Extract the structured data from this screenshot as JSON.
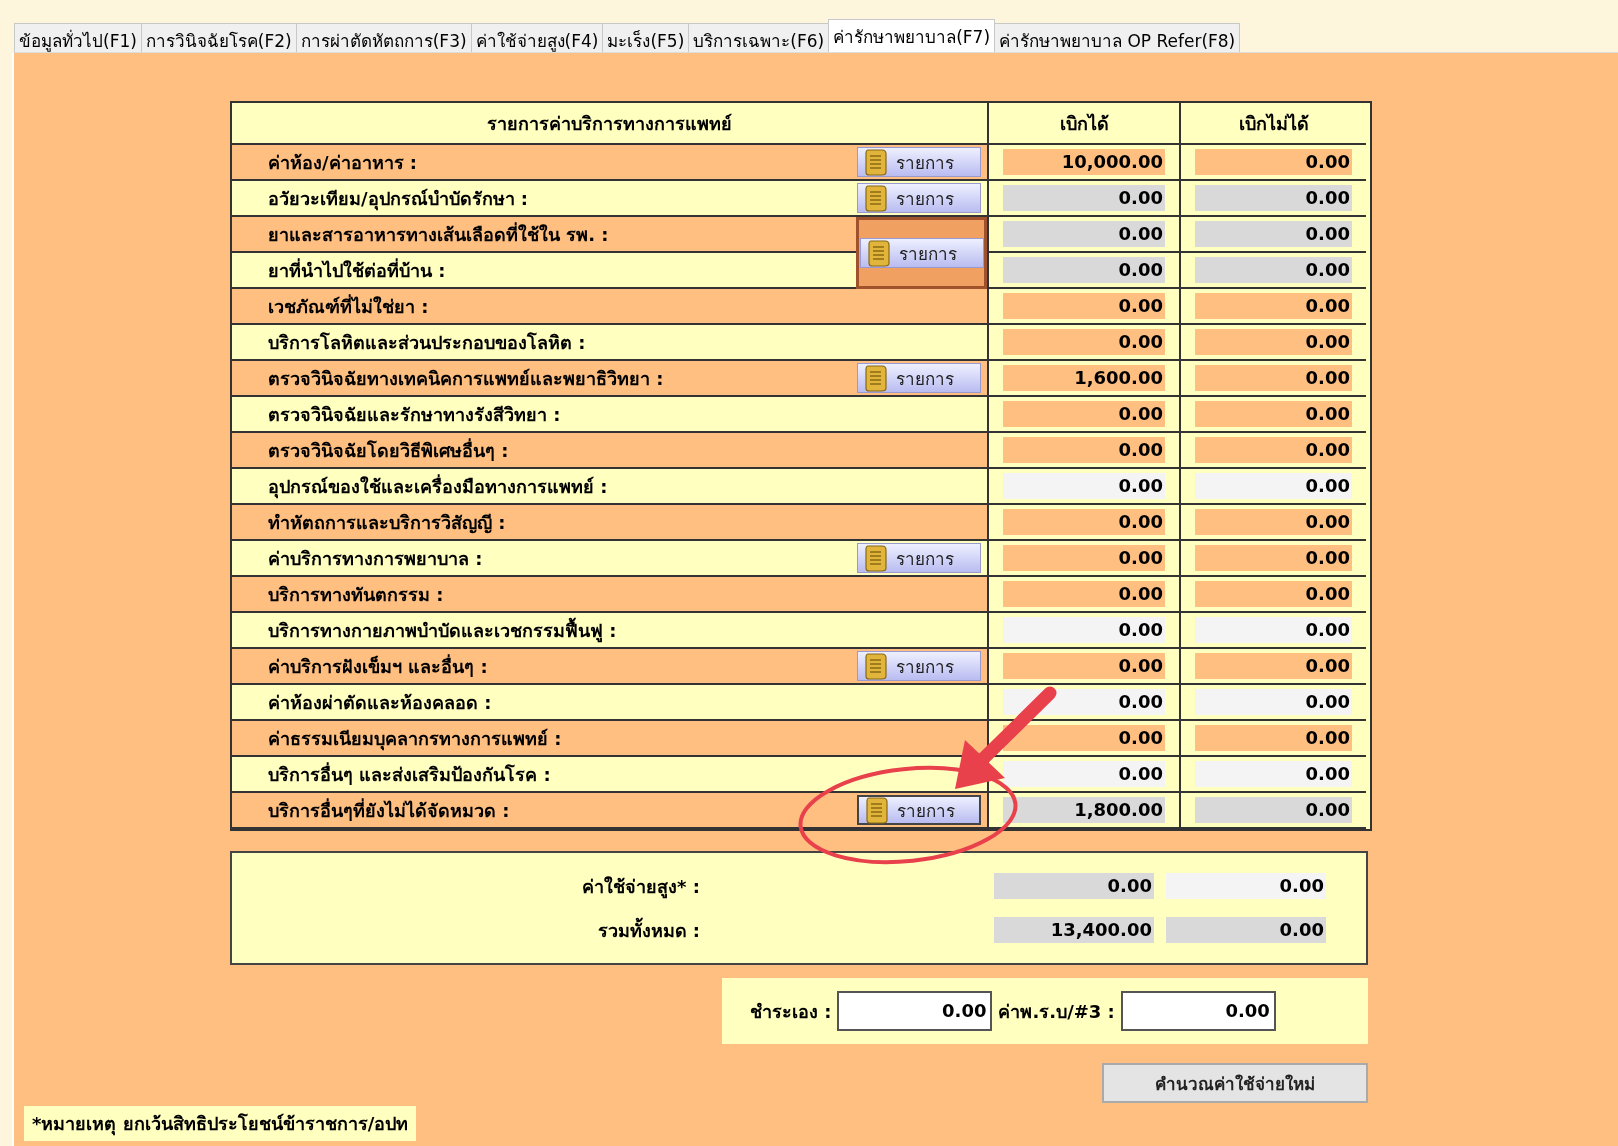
{
  "tabs": [
    {
      "label": "ข้อมูลทั่วไป(F1)",
      "selected": false
    },
    {
      "label": "การวินิจฉัยโรค(F2)",
      "selected": false
    },
    {
      "label": "การผ่าตัดหัตถการ(F3)",
      "selected": false
    },
    {
      "label": "ค่าใช้จ่ายสูง(F4)",
      "selected": false
    },
    {
      "label": "มะเร็ง(F5)",
      "selected": false
    },
    {
      "label": "บริการเฉพาะ(F6)",
      "selected": false
    },
    {
      "label": "ค่ารักษาพยาบาล(F7)",
      "selected": true
    },
    {
      "label": "ค่ารักษาพยาบาล OP Refer(F8)",
      "selected": false
    }
  ],
  "table": {
    "columns": [
      "รายการค่าบริการทางการแพทย์",
      "เบิกได้",
      "เบิกไม่ได้"
    ],
    "rows": [
      {
        "label": "ค่าห้อง/ค่าอาหาร :",
        "button": {
          "label": "รายการ",
          "highlighted": false,
          "focused": false
        },
        "claimable": {
          "value": "10,000.00",
          "color": "#ffbf80"
        },
        "non_claimable": {
          "value": "0.00",
          "color": "#ffbf80"
        }
      },
      {
        "label": "อวัยวะเทียม/อุปกรณ์บำบัดรักษา :",
        "button": {
          "label": "รายการ",
          "highlighted": false,
          "focused": false
        },
        "claimable": {
          "value": "0.00",
          "color": "#d9d9d9"
        },
        "non_claimable": {
          "value": "0.00",
          "color": "#d9d9d9"
        }
      },
      {
        "label": "ยาและสารอาหารทางเส้นเลือดที่ใช้ใน รพ. :",
        "button": {
          "label": "รายการ",
          "spans_next": true,
          "highlighted": true,
          "focused": false
        },
        "claimable": {
          "value": "0.00",
          "color": "#d9d9d9"
        },
        "non_claimable": {
          "value": "0.00",
          "color": "#d9d9d9"
        }
      },
      {
        "label": "ยาที่นำไปใช้ต่อที่บ้าน :",
        "claimable": {
          "value": "0.00",
          "color": "#d9d9d9"
        },
        "non_claimable": {
          "value": "0.00",
          "color": "#d9d9d9"
        }
      },
      {
        "label": "เวชภัณฑ์ที่ไม่ใช่ยา :",
        "claimable": {
          "value": "0.00",
          "color": "#ffbf80"
        },
        "non_claimable": {
          "value": "0.00",
          "color": "#ffbf80"
        }
      },
      {
        "label": "บริการโลหิตและส่วนประกอบของโลหิต :",
        "claimable": {
          "value": "0.00",
          "color": "#ffbf80"
        },
        "non_claimable": {
          "value": "0.00",
          "color": "#ffbf80"
        }
      },
      {
        "label": "ตรวจวินิจฉัยทางเทคนิคการแพทย์และพยาธิวิทยา :",
        "button": {
          "label": "รายการ",
          "highlighted": false,
          "focused": false
        },
        "claimable": {
          "value": "1,600.00",
          "color": "#ffbf80"
        },
        "non_claimable": {
          "value": "0.00",
          "color": "#ffbf80"
        }
      },
      {
        "label": "ตรวจวินิจฉัยและรักษาทางรังสีวิทยา :",
        "claimable": {
          "value": "0.00",
          "color": "#ffbf80"
        },
        "non_claimable": {
          "value": "0.00",
          "color": "#ffbf80"
        }
      },
      {
        "label": "ตรวจวินิจฉัยโดยวิธีพิเศษอื่นๆ :",
        "claimable": {
          "value": "0.00",
          "color": "#ffbf80"
        },
        "non_claimable": {
          "value": "0.00",
          "color": "#ffbf80"
        }
      },
      {
        "label": "อุปกรณ์ของใช้และเครื่องมือทางการแพทย์ :",
        "claimable": {
          "value": "0.00",
          "color": "#f4f4f4"
        },
        "non_claimable": {
          "value": "0.00",
          "color": "#f4f4f4"
        }
      },
      {
        "label": "ทำหัตถการและบริการวิสัญญี :",
        "claimable": {
          "value": "0.00",
          "color": "#ffbf80"
        },
        "non_claimable": {
          "value": "0.00",
          "color": "#ffbf80"
        }
      },
      {
        "label": "ค่าบริการทางการพยาบาล :",
        "button": {
          "label": "รายการ",
          "highlighted": false,
          "focused": false
        },
        "claimable": {
          "value": "0.00",
          "color": "#ffbf80"
        },
        "non_claimable": {
          "value": "0.00",
          "color": "#ffbf80"
        }
      },
      {
        "label": "บริการทางทันตกรรม :",
        "claimable": {
          "value": "0.00",
          "color": "#ffbf80"
        },
        "non_claimable": {
          "value": "0.00",
          "color": "#ffbf80"
        }
      },
      {
        "label": "บริการทางกายภาพบำบัดและเวชกรรมฟื้นฟู :",
        "claimable": {
          "value": "0.00",
          "color": "#f4f4f4"
        },
        "non_claimable": {
          "value": "0.00",
          "color": "#f4f4f4"
        }
      },
      {
        "label": "ค่าบริการฝังเข็มฯ และอื่นๆ :",
        "button": {
          "label": "รายการ",
          "highlighted": false,
          "focused": false
        },
        "claimable": {
          "value": "0.00",
          "color": "#ffbf80"
        },
        "non_claimable": {
          "value": "0.00",
          "color": "#ffbf80"
        }
      },
      {
        "label": "ค่าห้องผ่าตัดและห้องคลอด :",
        "claimable": {
          "value": "0.00",
          "color": "#f4f4f4"
        },
        "non_claimable": {
          "value": "0.00",
          "color": "#f4f4f4"
        }
      },
      {
        "label": "ค่าธรรมเนียมบุคลากรทางการแพทย์ :",
        "claimable": {
          "value": "0.00",
          "color": "#ffbf80"
        },
        "non_claimable": {
          "value": "0.00",
          "color": "#ffbf80"
        }
      },
      {
        "label": "บริการอื่นๆ และส่งเสริมป้องกันโรค :",
        "claimable": {
          "value": "0.00",
          "color": "#f4f4f4"
        },
        "non_claimable": {
          "value": "0.00",
          "color": "#f4f4f4"
        }
      },
      {
        "label": "บริการอื่นๆที่ยังไม่ได้จัดหมวด :",
        "button": {
          "label": "รายการ",
          "highlighted": false,
          "focused": true
        },
        "claimable": {
          "value": "1,800.00",
          "color": "#d9d9d9"
        },
        "non_claimable": {
          "value": "0.00",
          "color": "#d9d9d9"
        }
      }
    ]
  },
  "summary": [
    {
      "label": "ค่าใช้จ่ายสูง* :",
      "claimable": {
        "value": "0.00",
        "color": "#d9d9d9"
      },
      "non_claimable": {
        "value": "0.00",
        "color": "#f4f4f4"
      }
    },
    {
      "label": "รวมทั้งหมด :",
      "claimable": {
        "value": "13,400.00",
        "color": "#d9d9d9"
      },
      "non_claimable": {
        "value": "0.00",
        "color": "#d9d9d9"
      }
    }
  ],
  "payment": [
    {
      "label": "ชำระเอง :",
      "value": "0.00"
    },
    {
      "label": "ค่าพ.ร.บ/#3 :",
      "value": "0.00"
    }
  ],
  "recalculate_button": "คำนวณค่าใช้จ่ายใหม่",
  "note": "*หมายเหตุ ยกเว้นสิทธิประโยชน์ข้าราชการ/อปท"
}
